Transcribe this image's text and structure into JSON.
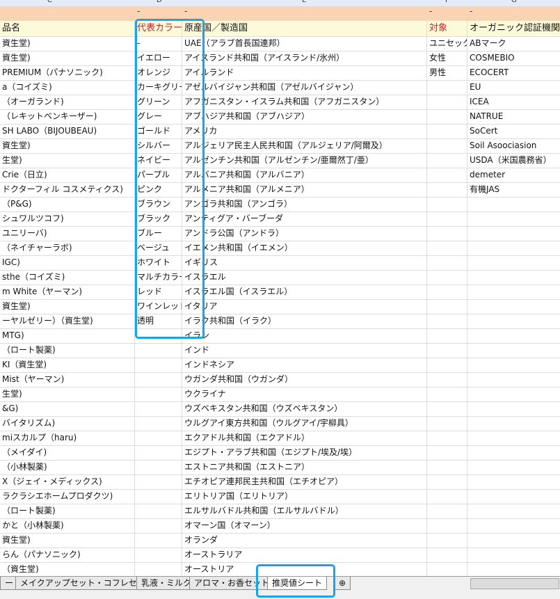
{
  "columns": [
    "C",
    "D",
    "E",
    "F",
    "G"
  ],
  "dash_row": [
    "",
    "-",
    "-",
    "-",
    "-"
  ],
  "header_row": [
    "品名",
    "代表カラー",
    "原産国／製造国",
    "対象",
    "オーガニック認証機関・"
  ],
  "rows": [
    [
      "資生堂)",
      "-",
      "UAE（アラブ首長国連邦）",
      "ユニセックス",
      "ABマーク"
    ],
    [
      "資生堂)",
      "イエロー",
      "アイスランド共和国（アイスランド/氷州）",
      "女性",
      "COSMEBIO"
    ],
    [
      " PREMIUM（パナソニック)",
      "オレンジ",
      "アイルランド",
      "男性",
      "ECOCERT"
    ],
    [
      "a（コイズミ)",
      "カーキグリーン",
      "アゼルバイジャン共和国（アゼルバイジャン）",
      "",
      "EU"
    ],
    [
      "（オーガランド)",
      "グリーン",
      "アフガニスタン・イスラム共和国（アフガニスタン）",
      "",
      "ICEA"
    ],
    [
      "（レキットベンキーザー)",
      "グレー",
      "アブハジア共和国（アブハジア）",
      "",
      "NATRUE"
    ],
    [
      "SH LABO（BIJOUBEAU)",
      "ゴールド",
      "アメリカ",
      "",
      "SoCert"
    ],
    [
      "資生堂)",
      "シルバー",
      "アルジェリア民主人民共和国（アルジェリア/阿爾及）",
      "",
      "Soil Asoociasion"
    ],
    [
      "生堂)",
      "ネイビー",
      "アルゼンチン共和国（アルゼンチン/亜爾然丁/亜）",
      "",
      "USDA（米国農務省）"
    ],
    [
      "Crie（日立)",
      "パープル",
      "アルバニア共和国（アルバニア）",
      "",
      "demeter"
    ],
    [
      "ドクターフィル コスメティクス)",
      "ピンク",
      "アルメニア共和国（アルメニア）",
      "",
      "有機JAS"
    ],
    [
      "（P&G)",
      "ブラウン",
      "アンゴラ共和国（アンゴラ）",
      "",
      ""
    ],
    [
      "シュワルツコフ)",
      "ブラック",
      "アンティグア・バーブーダ",
      "",
      ""
    ],
    [
      "ユニリーバ)",
      "ブルー",
      "アンドラ公国（アンドラ）",
      "",
      ""
    ],
    [
      "（ネイチャーラボ)",
      "ベージュ",
      "イエメン共和国（イエメン）",
      "",
      ""
    ],
    [
      "IGC)",
      "ホワイト",
      "イギリス",
      "",
      ""
    ],
    [
      "sthe（コイズミ)",
      "マルチカラー",
      "イスラエル",
      "",
      ""
    ],
    [
      "m White（ヤーマン)",
      "レッド",
      "イスラエル国（イスラエル）",
      "",
      ""
    ],
    [
      "資生堂)",
      "ワインレッド",
      "イタリア",
      "",
      ""
    ],
    [
      "ーヤルゼリー）（資生堂)",
      "透明",
      "イラク共和国（イラク）",
      "",
      ""
    ],
    [
      "MTG)",
      "",
      "イラン",
      "",
      ""
    ],
    [
      "（ロート製薬)",
      "",
      "インド",
      "",
      ""
    ],
    [
      "KI（資生堂)",
      "",
      "インドネシア",
      "",
      ""
    ],
    [
      "Mist（ヤーマン)",
      "",
      "ウガンダ共和国（ウガンダ）",
      "",
      ""
    ],
    [
      "生堂)",
      "",
      "ウクライナ",
      "",
      ""
    ],
    [
      "&G)",
      "",
      "ウズベキスタン共和国（ウズベキスタン）",
      "",
      ""
    ],
    [
      "バイタリズム)",
      "",
      "ウルグアイ東方共和国（ウルグアイ/宇柳具）",
      "",
      ""
    ],
    [
      "miスカルプ（haru)",
      "",
      "エクアドル共和国（エクアドル）",
      "",
      ""
    ],
    [
      "（メイダイ)",
      "",
      "エジプト・アラブ共和国（エジプト/埃及/埃）",
      "",
      ""
    ],
    [
      "（小林製薬)",
      "",
      "エストニア共和国（エストニア）",
      "",
      ""
    ],
    [
      "X（ジェイ・メディックス)",
      "",
      "エチオピア連邦民主共和国（エチオピア）",
      "",
      ""
    ],
    [
      "ラクラシエホームプロダクツ)",
      "",
      "エリトリア国（エリトリア）",
      "",
      ""
    ],
    [
      "（ロート製薬)",
      "",
      "エルサルバドル共和国（エルサルバドル）",
      "",
      ""
    ],
    [
      "かと（小林製薬)",
      "",
      "オマーン国（オマーン）",
      "",
      ""
    ],
    [
      "資生堂)",
      "",
      "オランダ",
      "",
      ""
    ],
    [
      "らん（パナソニック)",
      "",
      "オーストラリア",
      "",
      ""
    ],
    [
      "（資生堂)",
      "",
      "オーストリア",
      "",
      ""
    ]
  ],
  "tabs": [
    "ー",
    "メイクアップセット・コフレセット",
    "乳液・ミルク",
    "アロマ・お香セット",
    "推奨値シート"
  ],
  "active_tab": "推奨値シート",
  "highlight_color": "#1aa3e8",
  "header_accent_color": "#c0262a"
}
